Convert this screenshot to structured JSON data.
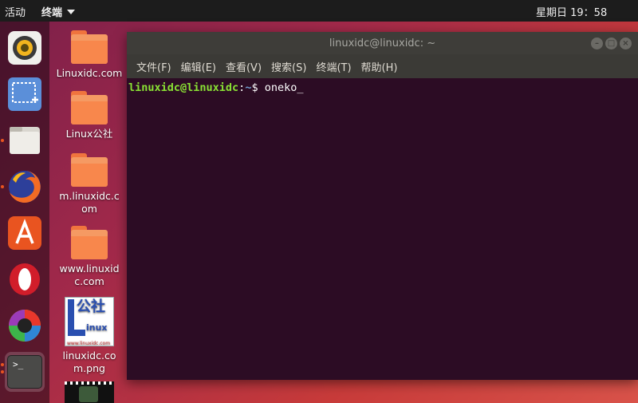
{
  "topbar": {
    "activities": "活动",
    "app_menu": "终端",
    "clock": "星期日 19：58"
  },
  "dock": {
    "items": [
      {
        "name": "rhythmbox",
        "icon": "speaker-icon"
      },
      {
        "name": "screenshot",
        "icon": "screenshot-icon"
      },
      {
        "name": "files",
        "icon": "folder-icon"
      },
      {
        "name": "firefox",
        "icon": "firefox-icon"
      },
      {
        "name": "software",
        "icon": "app-store-icon"
      },
      {
        "name": "opera",
        "icon": "opera-icon"
      },
      {
        "name": "color-app",
        "icon": "color-wheel-icon"
      },
      {
        "name": "terminal",
        "icon": "terminal-icon"
      }
    ],
    "terminal_glyph": ">_"
  },
  "desktop": {
    "icons": [
      {
        "label": "Linuxidc.com",
        "type": "folder"
      },
      {
        "label": "Linux公社",
        "type": "folder"
      },
      {
        "label": "m.linuxidc.com",
        "type": "folder"
      },
      {
        "label": "www.linuxidc.com",
        "type": "folder"
      },
      {
        "label": "linuxidc.com.png",
        "type": "image"
      },
      {
        "label": "",
        "type": "video"
      }
    ],
    "thumb_text_main": "公社",
    "thumb_text_sub": "inux",
    "thumb_url": "www.linuxidc.com"
  },
  "terminal": {
    "title": "linuxidc@linuxidc: ~",
    "menu": [
      "文件(F)",
      "编辑(E)",
      "查看(V)",
      "搜索(S)",
      "终端(T)",
      "帮助(H)"
    ],
    "prompt_user": "linuxidc@linuxidc",
    "prompt_sep": ":",
    "prompt_path": "~",
    "prompt_sym": "$ ",
    "command": "oneko_"
  },
  "colors": {
    "accent": "#e95420",
    "terminal_bg": "#2c0c24",
    "prompt_green": "#8ae234",
    "prompt_blue": "#729fcf"
  }
}
